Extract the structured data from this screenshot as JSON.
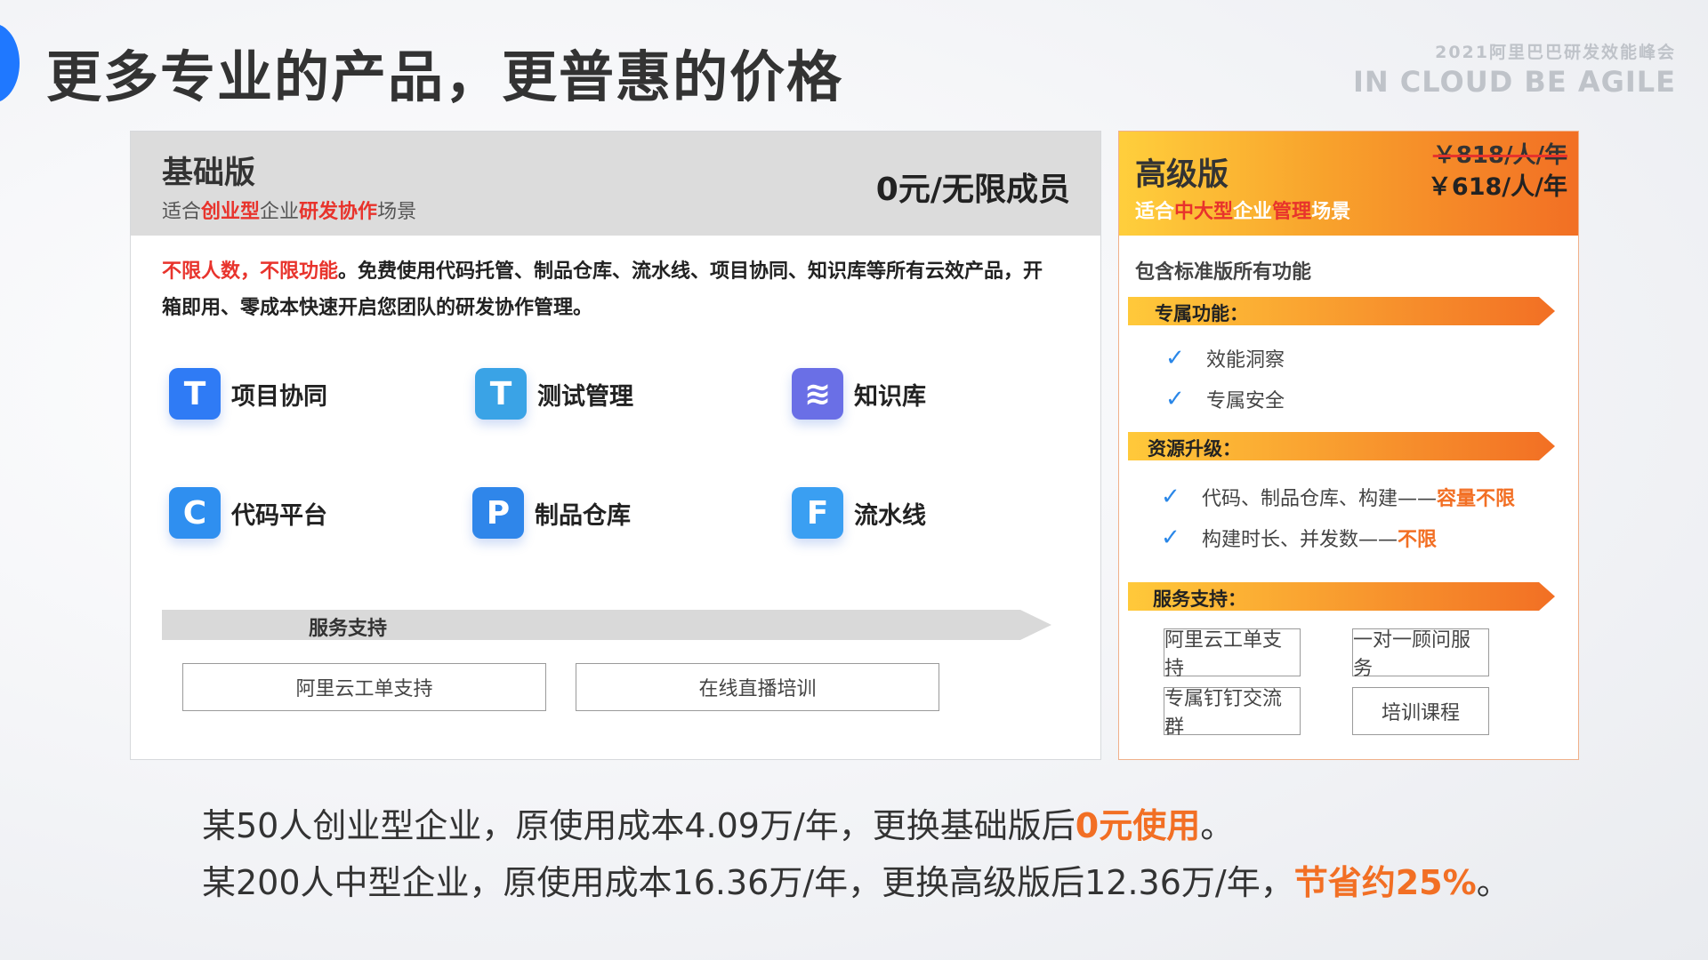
{
  "title": "更多专业的产品，更普惠的价格",
  "brand": {
    "line1": "2021阿里巴巴研发效能峰会",
    "line2": "IN CLOUD BE AGILE"
  },
  "basic": {
    "name": "基础版",
    "subtitle": {
      "p1": "适合",
      "p2": "创业型",
      "p3": "企业",
      "p4": "研发协作",
      "p5": "场景"
    },
    "price": "0元/无限成员",
    "desc": {
      "highlight": "不限人数，不限功能",
      "text": "。免费使用代码托管、制品仓库、流水线、项目协同、知识库等所有云效产品，开箱即用、零成本快速开启您团队的研发协作管理。"
    },
    "products": [
      {
        "label": "项目协同",
        "icon": "project-icon",
        "color": "#2f7bf5"
      },
      {
        "label": "测试管理",
        "icon": "test-icon",
        "color": "#3aa3e6"
      },
      {
        "label": "知识库",
        "icon": "knowledge-icon",
        "color": "#6a6fe6"
      },
      {
        "label": "代码平台",
        "icon": "code-icon",
        "color": "#2f8ff0"
      },
      {
        "label": "制品仓库",
        "icon": "artifact-icon",
        "color": "#2f86ea"
      },
      {
        "label": "流水线",
        "icon": "pipeline-icon",
        "color": "#3a9ff2"
      }
    ],
    "service_title": "服务支持",
    "services": [
      "阿里云工单支持",
      "在线直播培训"
    ]
  },
  "advanced": {
    "name": "高级版",
    "subtitle": {
      "p1": "适合",
      "p2": "中大型",
      "p3": "企业",
      "p4": "管理",
      "p5": "场景"
    },
    "old_price": "￥818/人/年",
    "new_price": "￥618/人/年",
    "include": "包含标准版所有功能",
    "exclusive_title": "专属功能：",
    "exclusive": [
      "效能洞察",
      "专属安全"
    ],
    "resource_title": "资源升级：",
    "resources": [
      {
        "text": "代码、制品仓库、构建——",
        "accent": "容量不限"
      },
      {
        "text": "构建时长、并发数——",
        "accent": "不限"
      }
    ],
    "service_title": "服务支持：",
    "services": [
      "阿里云工单支持",
      "一对一顾问服务",
      "专属钉钉交流群",
      "培训课程"
    ]
  },
  "summary": [
    {
      "text": "某50人创业型企业，原使用成本4.09万/年，更换基础版后",
      "accent": "0元使用",
      "tail": "。"
    },
    {
      "text": "某200人中型企业，原使用成本16.36万/年，更换高级版后12.36万/年，",
      "accent": "节省约25%",
      "tail": "。"
    }
  ],
  "colors": {
    "accent_orange": "#f26f24",
    "accent_red": "#e8332c",
    "brand_blue": "#1f78ff"
  }
}
